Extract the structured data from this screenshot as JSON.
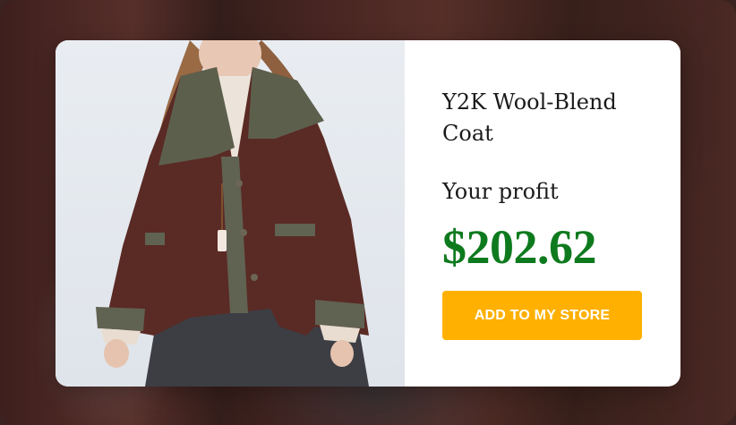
{
  "product": {
    "title": "Y2K Wool-Blend Coat",
    "profit_label": "Your profit",
    "profit_value": "$202.62",
    "cta_label": "ADD TO MY STORE"
  },
  "colors": {
    "profit": "#0e7a1e",
    "cta_background": "#ffb000",
    "cta_text": "#ffffff",
    "card_background": "#ffffff"
  }
}
